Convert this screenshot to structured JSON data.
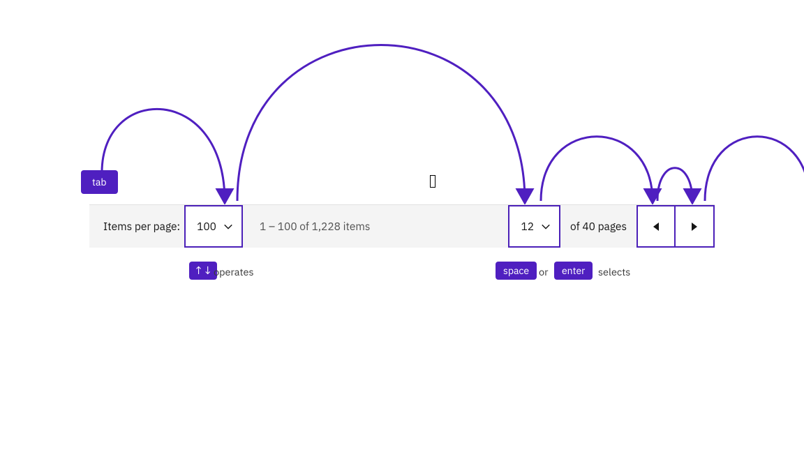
{
  "badges": {
    "tab": "tab",
    "arrows": "↑↓",
    "space": "space",
    "enter": "enter"
  },
  "hints": {
    "operates": "operates",
    "or": "or",
    "selects": "selects"
  },
  "pagination": {
    "items_per_page_label": "Items per page:",
    "items_per_page_value": "100",
    "range_summary": "1 – 100 of 1,228 items",
    "current_page": "12",
    "total_pages_text": "of 40 pages"
  },
  "colors": {
    "accent": "#4f1fc0",
    "bar_bg": "#f4f4f4"
  }
}
